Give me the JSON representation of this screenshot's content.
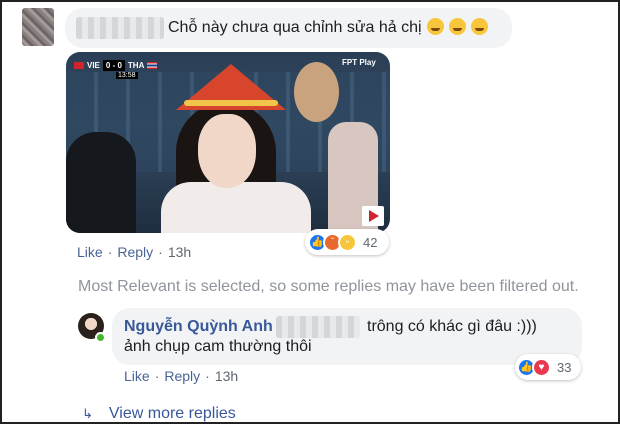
{
  "top_comment": {
    "text": "Chỗ này chưa qua chỉnh sửa hả chị",
    "emoji_icon": "baby-face-emoji",
    "actions": {
      "like": "Like",
      "reply": "Reply",
      "time": "13h"
    },
    "reaction_count": "42",
    "reactions": [
      "like",
      "angry",
      "haha"
    ],
    "image": {
      "score_team_a": "VIE",
      "score": "0 - 0",
      "score_team_b": "THA",
      "clock": "13:58",
      "broadcaster": "FPT Play"
    }
  },
  "filter_note": "Most Relevant is selected, so some replies may have been filtered out.",
  "reply": {
    "author": "Nguyễn Quỳnh Anh",
    "text_line1": "trông có khác gì đâu :)))",
    "text_line2": "ảnh chụp cam thường thôi",
    "actions": {
      "like": "Like",
      "reply": "Reply",
      "time": "13h"
    },
    "reaction_count": "33",
    "reactions": [
      "like",
      "love"
    ]
  },
  "view_more": "View more replies",
  "colors": {
    "link": "#385898",
    "bubble": "#f2f3f5",
    "meta": "#606770",
    "like_blue": "#1877f2"
  }
}
